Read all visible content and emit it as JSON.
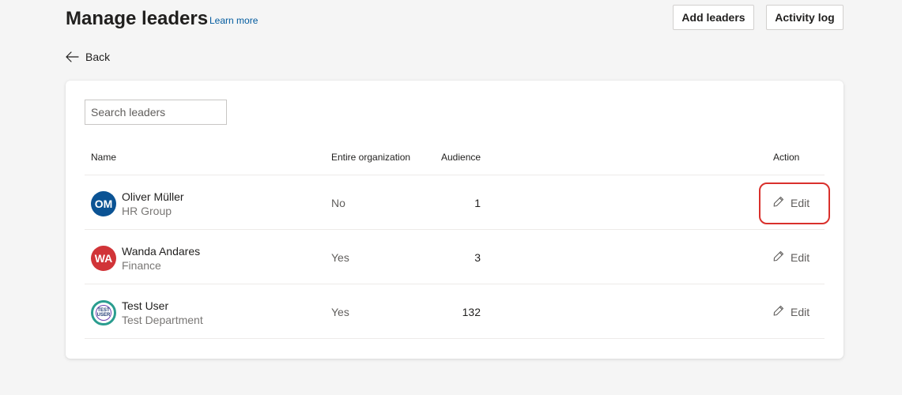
{
  "header": {
    "title": "Manage leaders",
    "learn_more": "Learn more",
    "add_leaders": "Add leaders",
    "activity_log": "Activity log",
    "back": "Back"
  },
  "search": {
    "placeholder": "Search leaders"
  },
  "table": {
    "columns": {
      "name": "Name",
      "entire_org": "Entire organization",
      "audience": "Audience",
      "action": "Action"
    },
    "rows": [
      {
        "initials": "OM",
        "avatar_color": "#0b5394",
        "name": "Oliver Müller",
        "department": "HR Group",
        "entire_org": "No",
        "audience": "1",
        "action": "Edit"
      },
      {
        "initials": "WA",
        "avatar_color": "#d13438",
        "name": "Wanda Andares",
        "department": "Finance",
        "entire_org": "Yes",
        "audience": "3",
        "action": "Edit"
      },
      {
        "initials": "TEST USER",
        "avatar_top": "TEST",
        "avatar_bottom": "USER",
        "name": "Test User",
        "department": "Test Department",
        "entire_org": "Yes",
        "audience": "132",
        "action": "Edit"
      }
    ]
  },
  "annotation": {
    "highlight_color": "#d9302c"
  },
  "icons": {
    "back": "arrow-left-icon",
    "edit": "pencil-icon"
  }
}
